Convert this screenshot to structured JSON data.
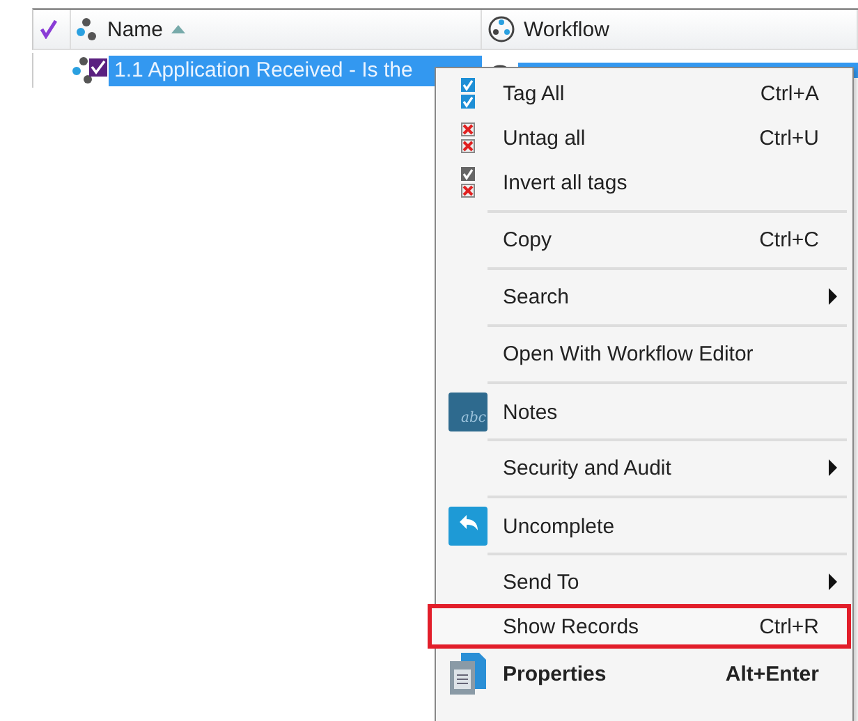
{
  "table": {
    "columns": [
      {
        "label": "Name",
        "sorted": true
      },
      {
        "label": "Workflow",
        "sorted": false
      }
    ],
    "rows": [
      {
        "tagged": true,
        "selected": true,
        "cells": [
          "1.1 Application Received - Is the"
        ]
      }
    ]
  },
  "context_menu": {
    "items": [
      {
        "label": "Tag All",
        "shortcut": "Ctrl+A",
        "separator_after": false
      },
      {
        "label": "Untag all",
        "shortcut": "Ctrl+U",
        "separator_after": false
      },
      {
        "label": "Invert all tags",
        "separator_after": true
      },
      {
        "label": "Copy",
        "shortcut": "Ctrl+C",
        "separator_after": true
      },
      {
        "label": "Search",
        "submenu": true,
        "separator_after": true
      },
      {
        "label": "Open With Workflow Editor",
        "separator_after": true
      },
      {
        "label": "Notes",
        "icon_text": "abc",
        "separator_after": true
      },
      {
        "label": "Security and Audit",
        "submenu": true,
        "separator_after": true
      },
      {
        "label": "Uncomplete",
        "separator_after": true
      },
      {
        "label": "Send To",
        "submenu": true,
        "separator_after": false
      },
      {
        "label": "Show Records",
        "shortcut": "Ctrl+R",
        "highlighted": true,
        "separator_after": false
      },
      {
        "label": "Properties",
        "shortcut": "Alt+Enter",
        "bold": true,
        "separator_after": false
      }
    ]
  }
}
